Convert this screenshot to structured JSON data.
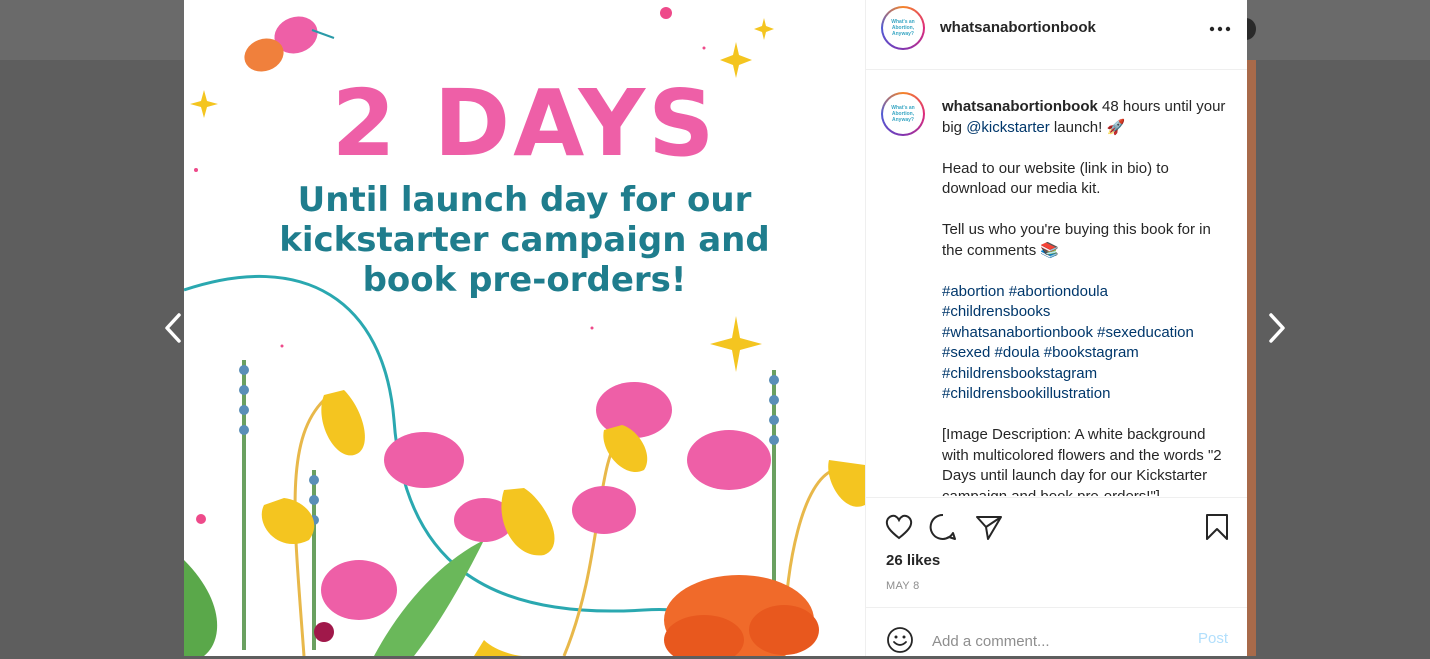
{
  "post": {
    "username": "whatsanabortionbook",
    "avatar_text": "What's an Abortion, Anyway?",
    "image": {
      "headline": "2 DAYS",
      "subheadline": "Until launch day for our kickstarter campaign and book pre-orders!"
    },
    "caption": {
      "username": "whatsanabortionbook",
      "line1": " 48 hours until your big ",
      "mention": "@kickstarter",
      "line1_end": " launch! 🚀",
      "para2": "Head to our website (link in bio) to download our media kit.",
      "para3": "Tell us who you're buying this book for in the comments 📚",
      "hashtags": "#abortion #abortiondoula\n#childrensbooks\n#whatsanabortionbook #sexeducation\n#sexed #doula #bookstagram\n#childrensbookstagram\n#childrensbookillustration",
      "para5": "[Image Description: A white background with multicolored flowers and the words \"2 Days until launch day for our Kickstarter campaign and book pre-orders!\"]"
    },
    "likes": "26 likes",
    "date": "MAY 8",
    "comment_placeholder": "Add a comment...",
    "post_label": "Post"
  },
  "icons": {
    "like": "heart-icon",
    "comment": "comment-icon",
    "share": "paper-plane-icon",
    "save": "bookmark-icon",
    "more": "more-dots-icon",
    "emoji": "emoji-icon",
    "prev": "chevron-left-icon",
    "next": "chevron-right-icon"
  },
  "colors": {
    "headline_pink": "#ee5fa7",
    "headline_teal": "#1f7d8d",
    "link": "#00376b",
    "post_button_disabled": "#b2dffc"
  }
}
